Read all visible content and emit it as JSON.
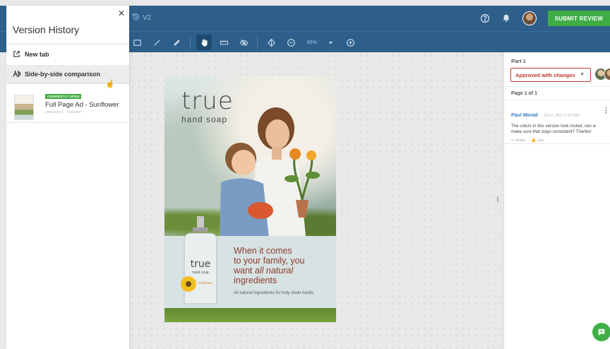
{
  "topbar": {
    "version_label": "V2",
    "submit_label": "SUBMIT REVIEW",
    "icons": [
      "help-icon",
      "bell-icon",
      "avatar"
    ]
  },
  "toolbar": {
    "zoom_value": "86%",
    "tools": [
      "rectangle-tool",
      "line-tool",
      "pencil-tool",
      "hand-tool",
      "ruler-tool",
      "hide-icon",
      "compare-icon",
      "zoom-out-icon",
      "zoom-dropdown",
      "zoom-in-icon"
    ]
  },
  "drawer": {
    "title": "Version History",
    "new_tab_label": "New tab",
    "side_by_side_label": "Side-by-side comparison",
    "version": {
      "badge": "CURRENTLY OPEN",
      "name": "Full Page Ad - Sunflower",
      "meta": "VERSION 2 · 10/2/2017"
    }
  },
  "ad": {
    "brand": "true",
    "brand_sub": "hand soap",
    "tagline_1": "When it comes",
    "tagline_2": "to your family, you",
    "tagline_3a": "want ",
    "tagline_3b": "all natural",
    "tagline_4": "ingredients",
    "fineprint": "All natural ingredients for truly clean hands",
    "bottle_brand": "true",
    "bottle_sub": "hand soap",
    "bottle_variant": "Sunflower"
  },
  "panel": {
    "part_label": "Part 1",
    "status": "Approved with changes",
    "page_label": "Page 1 of 1",
    "comment": {
      "author": "Paul Morad",
      "date": "Oct 2, 2017 1:57 PM",
      "text_1": "The colors in this version look muted, can w",
      "text_2": "make sure that stays consistent? Thanks!",
      "reply": "Reply",
      "like": "Like"
    }
  },
  "colors": {
    "primary": "#2d5f8a",
    "accent_green": "#3eae45",
    "status_red": "#c0392b",
    "link_blue": "#3a7bbf"
  }
}
